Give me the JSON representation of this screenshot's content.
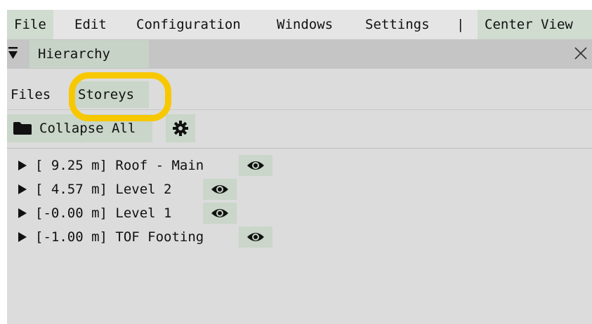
{
  "menubar": {
    "file": "File",
    "edit": "Edit",
    "configuration": "Configuration",
    "windows": "Windows",
    "settings": "Settings",
    "separator": "|",
    "center_view": "Center View"
  },
  "window": {
    "title": "Hierarchy"
  },
  "tabs": {
    "files": "Files",
    "storeys": "Storeys",
    "selected": "Storeys"
  },
  "toolbar": {
    "collapse_all": "Collapse All"
  },
  "tree": {
    "items": [
      {
        "label": "[ 9.25 m] Roof - Main"
      },
      {
        "label": "[ 4.57 m] Level 2"
      },
      {
        "label": "[-0.00 m] Level 1"
      },
      {
        "label": "[-1.00 m] TOF Footing"
      }
    ]
  },
  "colors": {
    "panel_bg": "#dcdcdc",
    "menubar_bg": "#e5e5e5",
    "titlebar_bg": "#c5c5c5",
    "button_bg": "#c9d6c9",
    "highlight": "#f7c800"
  },
  "icons": {
    "collapse_toggle": "triangle-down-icon",
    "close": "close-icon",
    "folder": "folder-icon",
    "settings": "gear-icon",
    "expand": "triangle-right-icon",
    "visibility": "eye-icon"
  }
}
